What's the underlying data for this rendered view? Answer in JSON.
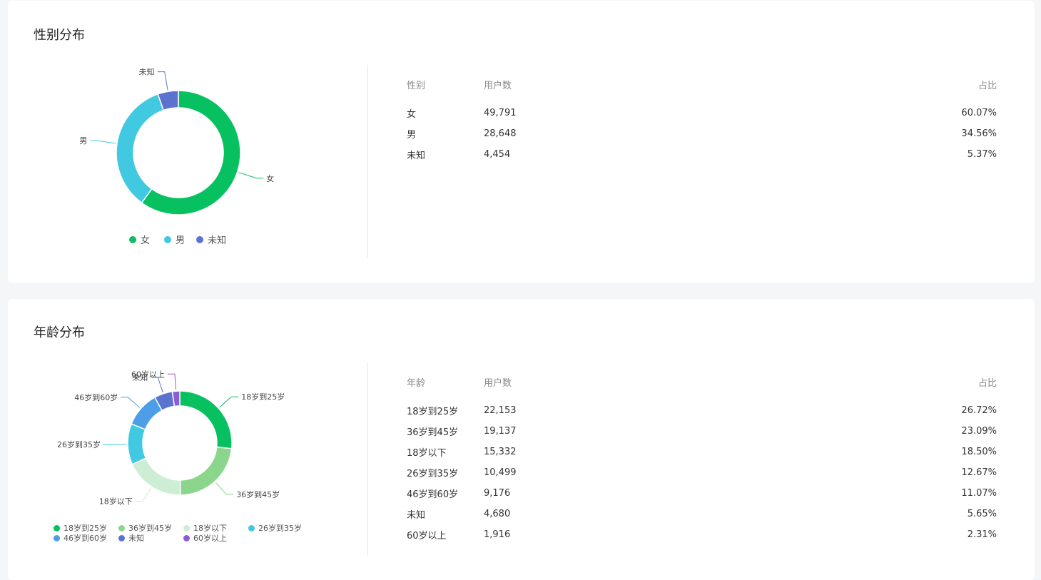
{
  "gender": {
    "title": "性别分布",
    "table": {
      "headers": [
        "性别",
        "用户数",
        "占比"
      ],
      "rows": [
        {
          "label": "女",
          "count": "49,791",
          "pct": "60.07%"
        },
        {
          "label": "男",
          "count": "28,648",
          "pct": "34.56%"
        },
        {
          "label": "未知",
          "count": "4,454",
          "pct": "5.37%"
        }
      ]
    }
  },
  "age": {
    "title": "年龄分布",
    "table": {
      "headers": [
        "年龄",
        "用户数",
        "占比"
      ],
      "rows": [
        {
          "label": "18岁到25岁",
          "count": "22,153",
          "pct": "26.72%"
        },
        {
          "label": "36岁到45岁",
          "count": "19,137",
          "pct": "23.09%"
        },
        {
          "label": "18岁以下",
          "count": "15,332",
          "pct": "18.50%"
        },
        {
          "label": "26岁到35岁",
          "count": "10,499",
          "pct": "12.67%"
        },
        {
          "label": "46岁到60岁",
          "count": "9,176",
          "pct": "11.07%"
        },
        {
          "label": "未知",
          "count": "4,680",
          "pct": "5.65%"
        },
        {
          "label": "60岁以上",
          "count": "1,916",
          "pct": "2.31%"
        }
      ]
    }
  },
  "chart_data": [
    {
      "type": "pie",
      "variant": "donut",
      "title": "性别分布",
      "categories": [
        "女",
        "男",
        "未知"
      ],
      "values": [
        49791,
        28648,
        4454
      ],
      "colors": [
        "#07c160",
        "#40c9e0",
        "#5b73cf"
      ],
      "legend": "bottom"
    },
    {
      "type": "pie",
      "variant": "donut",
      "title": "年龄分布",
      "categories": [
        "18岁到25岁",
        "36岁到45岁",
        "18岁以下",
        "26岁到35岁",
        "46岁到60岁",
        "未知",
        "60岁以上"
      ],
      "values": [
        22153,
        19137,
        15332,
        10499,
        9176,
        4680,
        1916
      ],
      "colors": [
        "#07c160",
        "#8bd68c",
        "#cdeed5",
        "#40c9e0",
        "#4c9ee8",
        "#5b73cf",
        "#8e5bd4"
      ],
      "legend": "bottom"
    }
  ]
}
